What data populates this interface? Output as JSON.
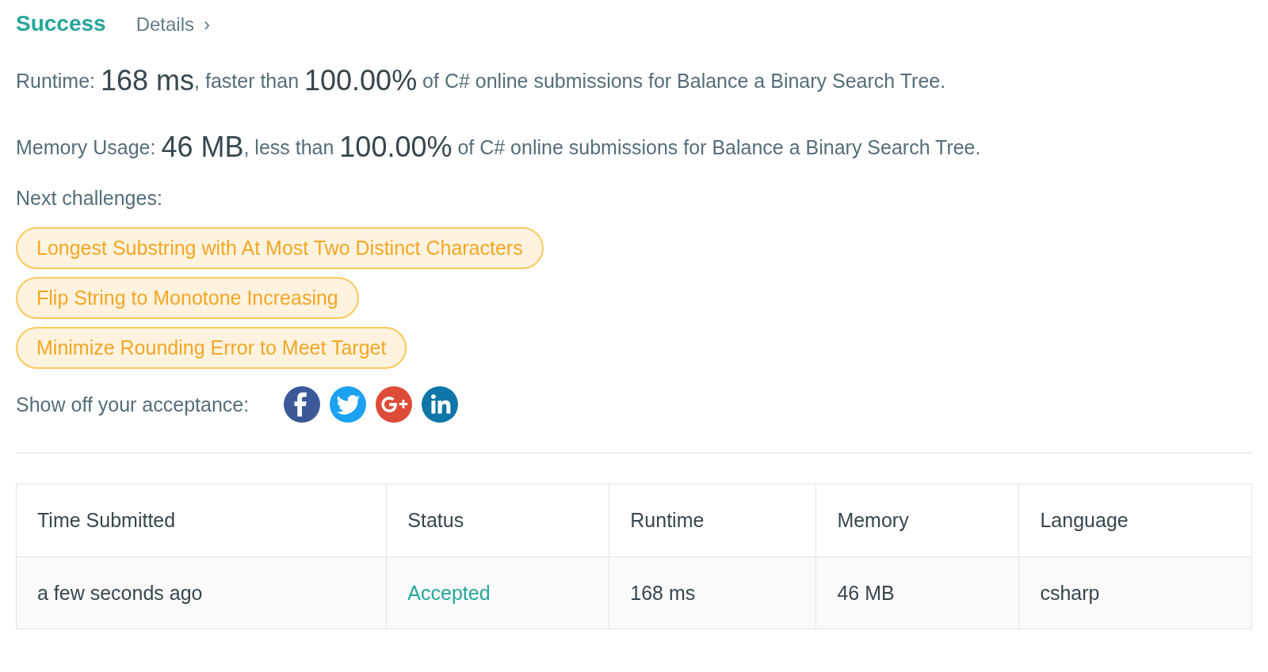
{
  "result": {
    "title": "Success",
    "details_link": "Details",
    "details_icon": "›"
  },
  "runtime": {
    "label": "Runtime: ",
    "value": "168 ms",
    "middle": ", faster than ",
    "percent": "100.00%",
    "tail": " of C# online submissions for Balance a Binary Search Tree."
  },
  "memory": {
    "label": "Memory Usage: ",
    "value": "46 MB",
    "middle": ", less than ",
    "percent": "100.00%",
    "tail": " of C# online submissions for Balance a Binary Search Tree."
  },
  "next_challenges": {
    "label": "Next challenges:",
    "items": [
      {
        "title": "Longest Substring with At Most Two Distinct Characters"
      },
      {
        "title": "Flip String to Monotone Increasing"
      },
      {
        "title": "Minimize Rounding Error to Meet Target"
      }
    ]
  },
  "share": {
    "label": "Show off your acceptance:",
    "buttons": [
      {
        "kind": "facebook",
        "color": "#3b5998"
      },
      {
        "kind": "twitter",
        "color": "#1da1f2"
      },
      {
        "kind": "googleplus",
        "color": "#dd4b39"
      },
      {
        "kind": "linkedin",
        "color": "#0e76a8"
      }
    ]
  },
  "table": {
    "columns": [
      "Time Submitted",
      "Status",
      "Runtime",
      "Memory",
      "Language"
    ],
    "rows": [
      {
        "time": "a few seconds ago",
        "status": "Accepted",
        "runtime": "168 ms",
        "memory": "46 MB",
        "language": "csharp"
      }
    ]
  }
}
